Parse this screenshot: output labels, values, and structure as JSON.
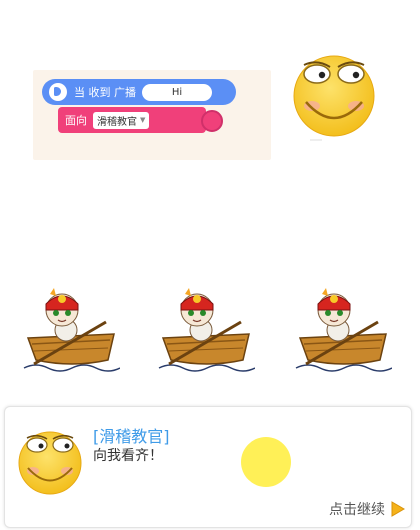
{
  "code_block": {
    "event_label": "当 收到 广播",
    "message_value": "Hi",
    "action_label": "面向",
    "target_value": "滑稽教官"
  },
  "dialog": {
    "speaker": "[滑稽教官]",
    "message": "向我看齐！",
    "continue_label": "点击继续"
  },
  "icons": {
    "event": "broadcast-icon",
    "continue": "play-triangle-icon",
    "character": "funny-smiley-face",
    "boat_character": "lion-rower-in-boat"
  },
  "colors": {
    "event_block": "#5b8ff5",
    "action_block": "#f0407a",
    "speaker_text": "#3f9be8",
    "continue_arrow": "#f5b21a",
    "smiley_face": "#f7c928"
  }
}
